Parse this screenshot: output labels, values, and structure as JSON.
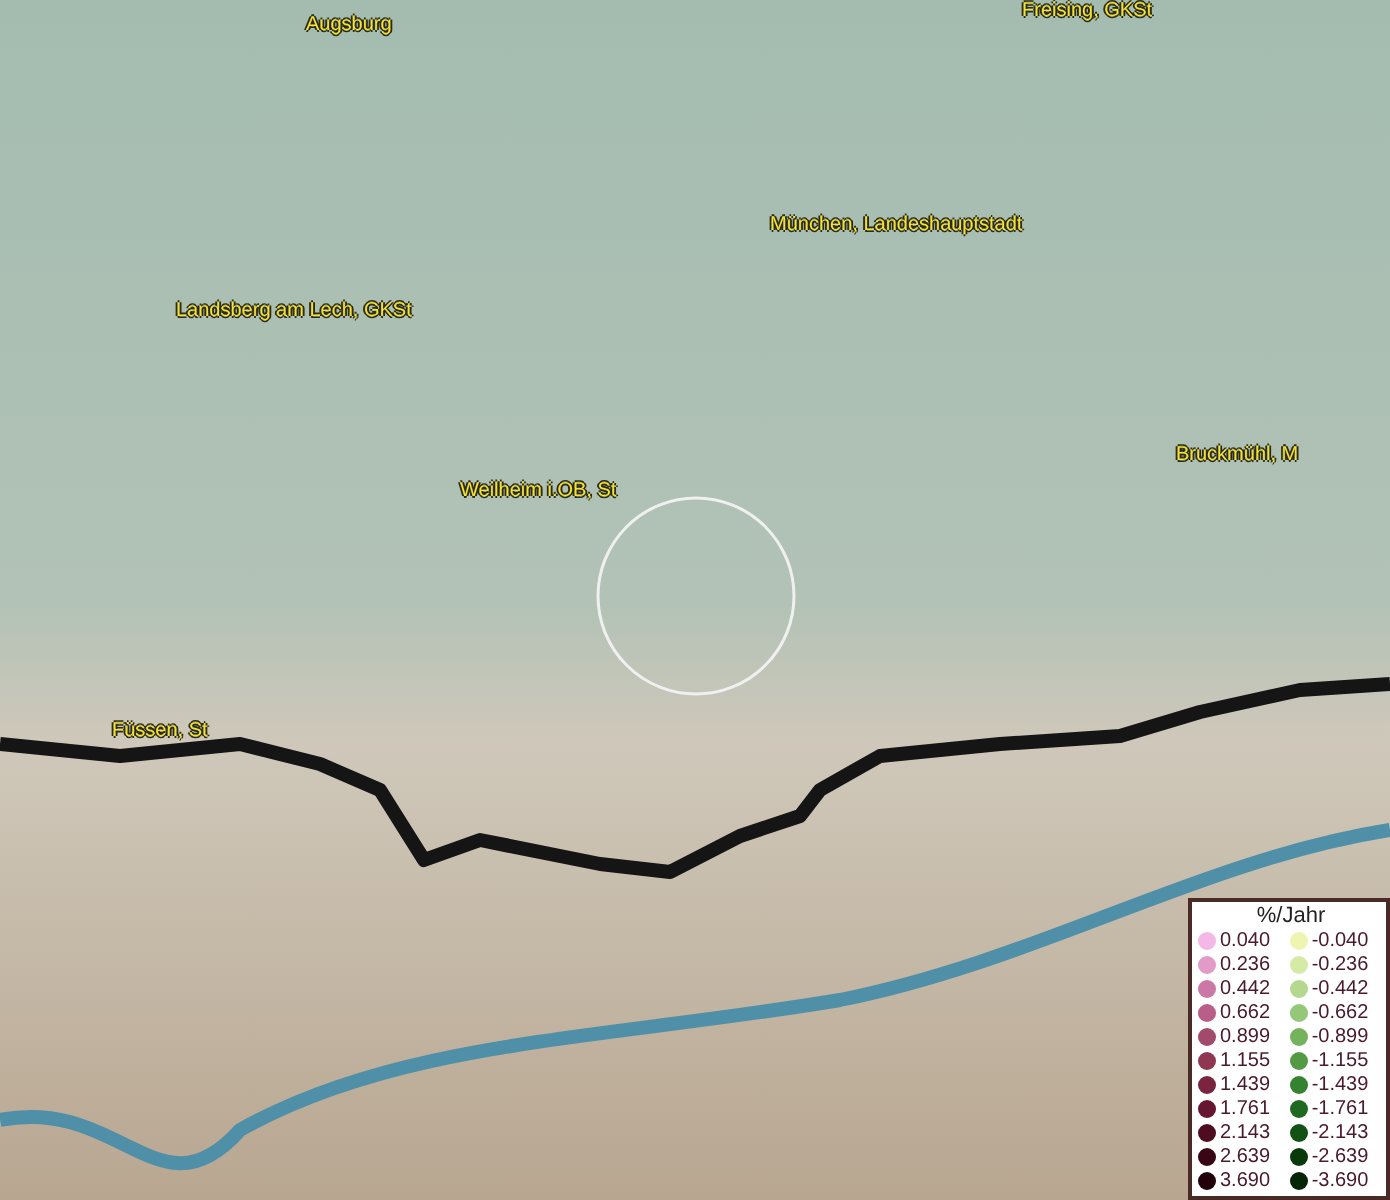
{
  "map": {
    "places": [
      {
        "name": "Augsburg"
      },
      {
        "name": "Freising, GKSt"
      },
      {
        "name": "München, Landeshauptstadt"
      },
      {
        "name": "Landsberg am Lech, GKSt"
      },
      {
        "name": "Weilheim i.OB, St"
      },
      {
        "name": "Bruckmühl, M"
      },
      {
        "name": "Füssen, St"
      }
    ]
  },
  "legend": {
    "title": "%/Jahr",
    "entries": [
      {
        "value": "0.040",
        "color": "#f4b8e8"
      },
      {
        "value": "-0.040",
        "color": "#eef5b0"
      },
      {
        "value": "0.236",
        "color": "#e29ac8"
      },
      {
        "value": "-0.236",
        "color": "#d4eaa6"
      },
      {
        "value": "0.442",
        "color": "#cc78a6"
      },
      {
        "value": "-0.442",
        "color": "#b4d98e"
      },
      {
        "value": "0.662",
        "color": "#b85e88"
      },
      {
        "value": "-0.662",
        "color": "#94c777"
      },
      {
        "value": "0.899",
        "color": "#a24a6c"
      },
      {
        "value": "-0.899",
        "color": "#74b25e"
      },
      {
        "value": "1.155",
        "color": "#8e3652"
      },
      {
        "value": "-1.155",
        "color": "#529a44"
      },
      {
        "value": "1.439",
        "color": "#7a2440"
      },
      {
        "value": "-1.439",
        "color": "#358230"
      },
      {
        "value": "1.761",
        "color": "#661630"
      },
      {
        "value": "-1.761",
        "color": "#1f6a20"
      },
      {
        "value": "2.143",
        "color": "#4e0c20"
      },
      {
        "value": "-2.143",
        "color": "#125214"
      },
      {
        "value": "2.639",
        "color": "#380614"
      },
      {
        "value": "-2.639",
        "color": "#0a3a0c"
      },
      {
        "value": "3.690",
        "color": "#22020a"
      },
      {
        "value": "-3.690",
        "color": "#062406"
      }
    ]
  }
}
